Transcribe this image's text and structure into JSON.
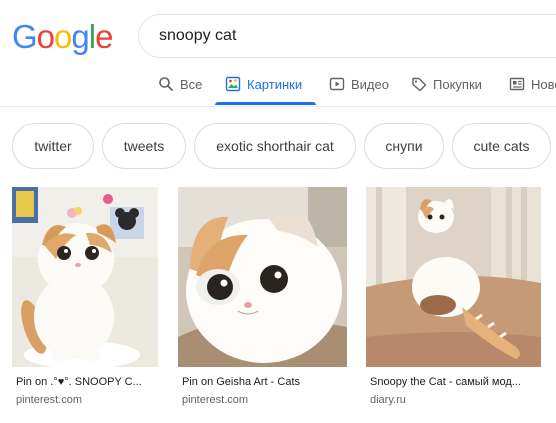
{
  "logo": {
    "letters": [
      "G",
      "o",
      "o",
      "g",
      "l",
      "e"
    ],
    "colors": [
      "#4285f4",
      "#ea4335",
      "#fbbc05",
      "#4285f4",
      "#34a853",
      "#ea4335"
    ]
  },
  "search": {
    "query": "snoopy cat"
  },
  "tabs": [
    {
      "label": "Все",
      "icon": "search-icon"
    },
    {
      "label": "Картинки",
      "icon": "image-icon",
      "active": true
    },
    {
      "label": "Видео",
      "icon": "video-icon"
    },
    {
      "label": "Покупки",
      "icon": "tag-icon"
    },
    {
      "label": "Ново",
      "icon": "news-icon"
    }
  ],
  "accent_color": "#1a73e8",
  "chips": [
    "twitter",
    "tweets",
    "exotic shorthair cat",
    "снупи",
    "cute cats"
  ],
  "results": [
    {
      "title": "Pin on .°♥°. SNOOPY C...",
      "source": "pinterest.com"
    },
    {
      "title": "Pin on Geisha Art - Cats",
      "source": "pinterest.com"
    },
    {
      "title": "Snoopy the Cat - самый мод...",
      "source": "diary.ru"
    }
  ]
}
